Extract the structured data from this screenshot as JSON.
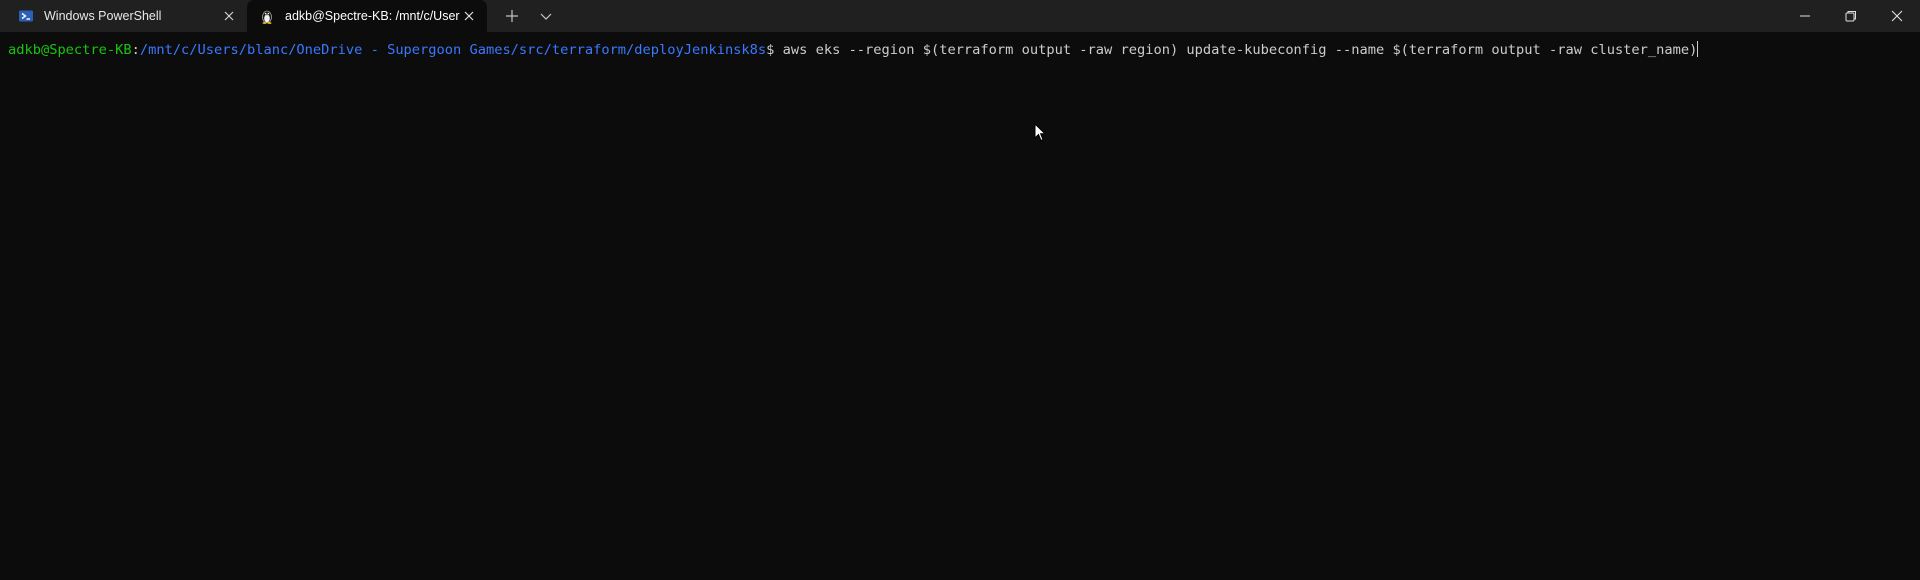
{
  "tabs": [
    {
      "title": "Windows PowerShell",
      "icon": "powershell-icon",
      "active": false
    },
    {
      "title": "adkb@Spectre-KB: /mnt/c/User",
      "icon": "linux-penguin-icon",
      "active": true
    }
  ],
  "titlebar": {
    "new_tab_icon": "plus-icon",
    "dropdown_icon": "chevron-down-icon",
    "window_controls": [
      "minimize-icon",
      "restore-icon",
      "close-icon"
    ]
  },
  "terminal": {
    "prompt_user": "adkb@Spectre-KB",
    "prompt_separator": ":",
    "prompt_path": "/mnt/c/Users/blanc/OneDrive - Supergoon Games/src/terraform/deployJenkinsk8s",
    "prompt_symbol": "$ ",
    "command": "aws eks --region $(terraform output -raw region) update-kubeconfig --name $(terraform output -raw cluster_name)"
  },
  "colors": {
    "background": "#0c0c0c",
    "titlebar": "#202020",
    "prompt_user": "#16c60c",
    "prompt_path": "#3b78ff",
    "text": "#cccccc"
  }
}
